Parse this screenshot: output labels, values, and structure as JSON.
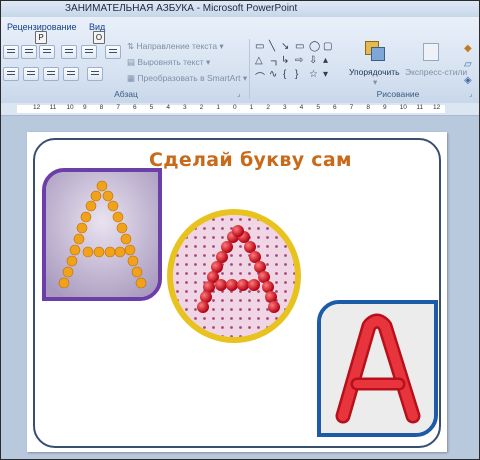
{
  "window": {
    "title": "ЗАНИМАТЕЛЬНАЯ АЗБУКА - Microsoft PowerPoint"
  },
  "tabs": [
    {
      "label": "Рецензирование",
      "keytip": "Р"
    },
    {
      "label": "Вид",
      "keytip": "О"
    }
  ],
  "ribbon": {
    "paragraph": {
      "group_label": "Абзац",
      "text_direction": "Направление текста",
      "align_text": "Выровнять текст",
      "smartart": "Преобразовать в SmartArt"
    },
    "drawing": {
      "group_label": "Рисование",
      "arrange": "Упорядочить",
      "quick_styles": "Экспресс-стили"
    }
  },
  "ruler": {
    "labels": [
      "12",
      "11",
      "10",
      "9",
      "8",
      "7",
      "6",
      "5",
      "4",
      "3",
      "2",
      "1",
      "0",
      "1",
      "2",
      "3",
      "4",
      "5",
      "6",
      "7",
      "8",
      "9",
      "10",
      "11",
      "12"
    ]
  },
  "slide": {
    "title": "Сделай букву сам",
    "title_color": "#c86a1a",
    "frame_colors": {
      "purple": "#6c3ea8",
      "yellow": "#e8c21d",
      "blue": "#1d5aa8"
    }
  }
}
